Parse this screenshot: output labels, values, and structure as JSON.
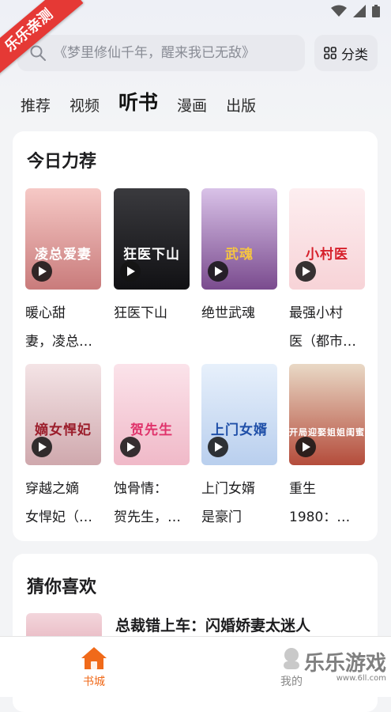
{
  "ribbon": "乐乐亲测",
  "search": {
    "placeholder": "《梦里修仙千年，醒来我已无敌》"
  },
  "category_button": "分类",
  "tabs": [
    {
      "label": "推荐"
    },
    {
      "label": "视频"
    },
    {
      "label": "听书",
      "active": true
    },
    {
      "label": "漫画"
    },
    {
      "label": "出版"
    }
  ],
  "today": {
    "title": "今日力荐",
    "books": [
      {
        "line1": "暖心甜",
        "line2": "妻，凌总…",
        "cover_text": "凌总爱妻",
        "bg1": "#f6c9c6",
        "bg2": "#c97b7b",
        "fg": "#ffffff"
      },
      {
        "line1": "狂医下山",
        "line2": "",
        "cover_text": "狂医下山",
        "bg1": "#3a3a3e",
        "bg2": "#111114",
        "fg": "#ffffff"
      },
      {
        "line1": "绝世武魂",
        "line2": "",
        "cover_text": "武魂",
        "bg1": "#d9c2e8",
        "bg2": "#7a4b8e",
        "fg": "#f5c542"
      },
      {
        "line1": "最强小村",
        "line2": "医（都市…",
        "cover_text": "小村医",
        "bg1": "#fdeef0",
        "bg2": "#f7d3d7",
        "fg": "#d6202b"
      },
      {
        "line1": "穿越之嫡",
        "line2": "女悍妃（…",
        "cover_text": "嫡女悍妃",
        "bg1": "#f4e4e6",
        "bg2": "#cfa8ad",
        "fg": "#9b1d2b"
      },
      {
        "line1": "蚀骨情：",
        "line2": "贺先生，…",
        "cover_text": "贺先生",
        "bg1": "#fbe3ea",
        "bg2": "#f0b9c8",
        "fg": "#e0336b"
      },
      {
        "line1": "上门女婿",
        "line2": "是豪门",
        "cover_text": "上门女婿",
        "bg1": "#e7f0fb",
        "bg2": "#b9cfee",
        "fg": "#1f4fa8"
      },
      {
        "line1": "重生",
        "line2": "1980：…",
        "cover_text": "开局迎娶姐姐闺蜜",
        "bg1": "#e9d9c6",
        "bg2": "#b44c3b",
        "fg": "#ffffff"
      }
    ]
  },
  "guess": {
    "title": "猜你喜欢",
    "first_title": "总裁错上车：闪婚娇妻太迷人"
  },
  "bottom_nav": {
    "home": "书城",
    "me": "我的"
  },
  "watermark": {
    "main": "乐乐游戏",
    "sub": "www.6ll.com"
  },
  "colors": {
    "accent": "#f06a1a",
    "ribbon": "#e53935"
  }
}
